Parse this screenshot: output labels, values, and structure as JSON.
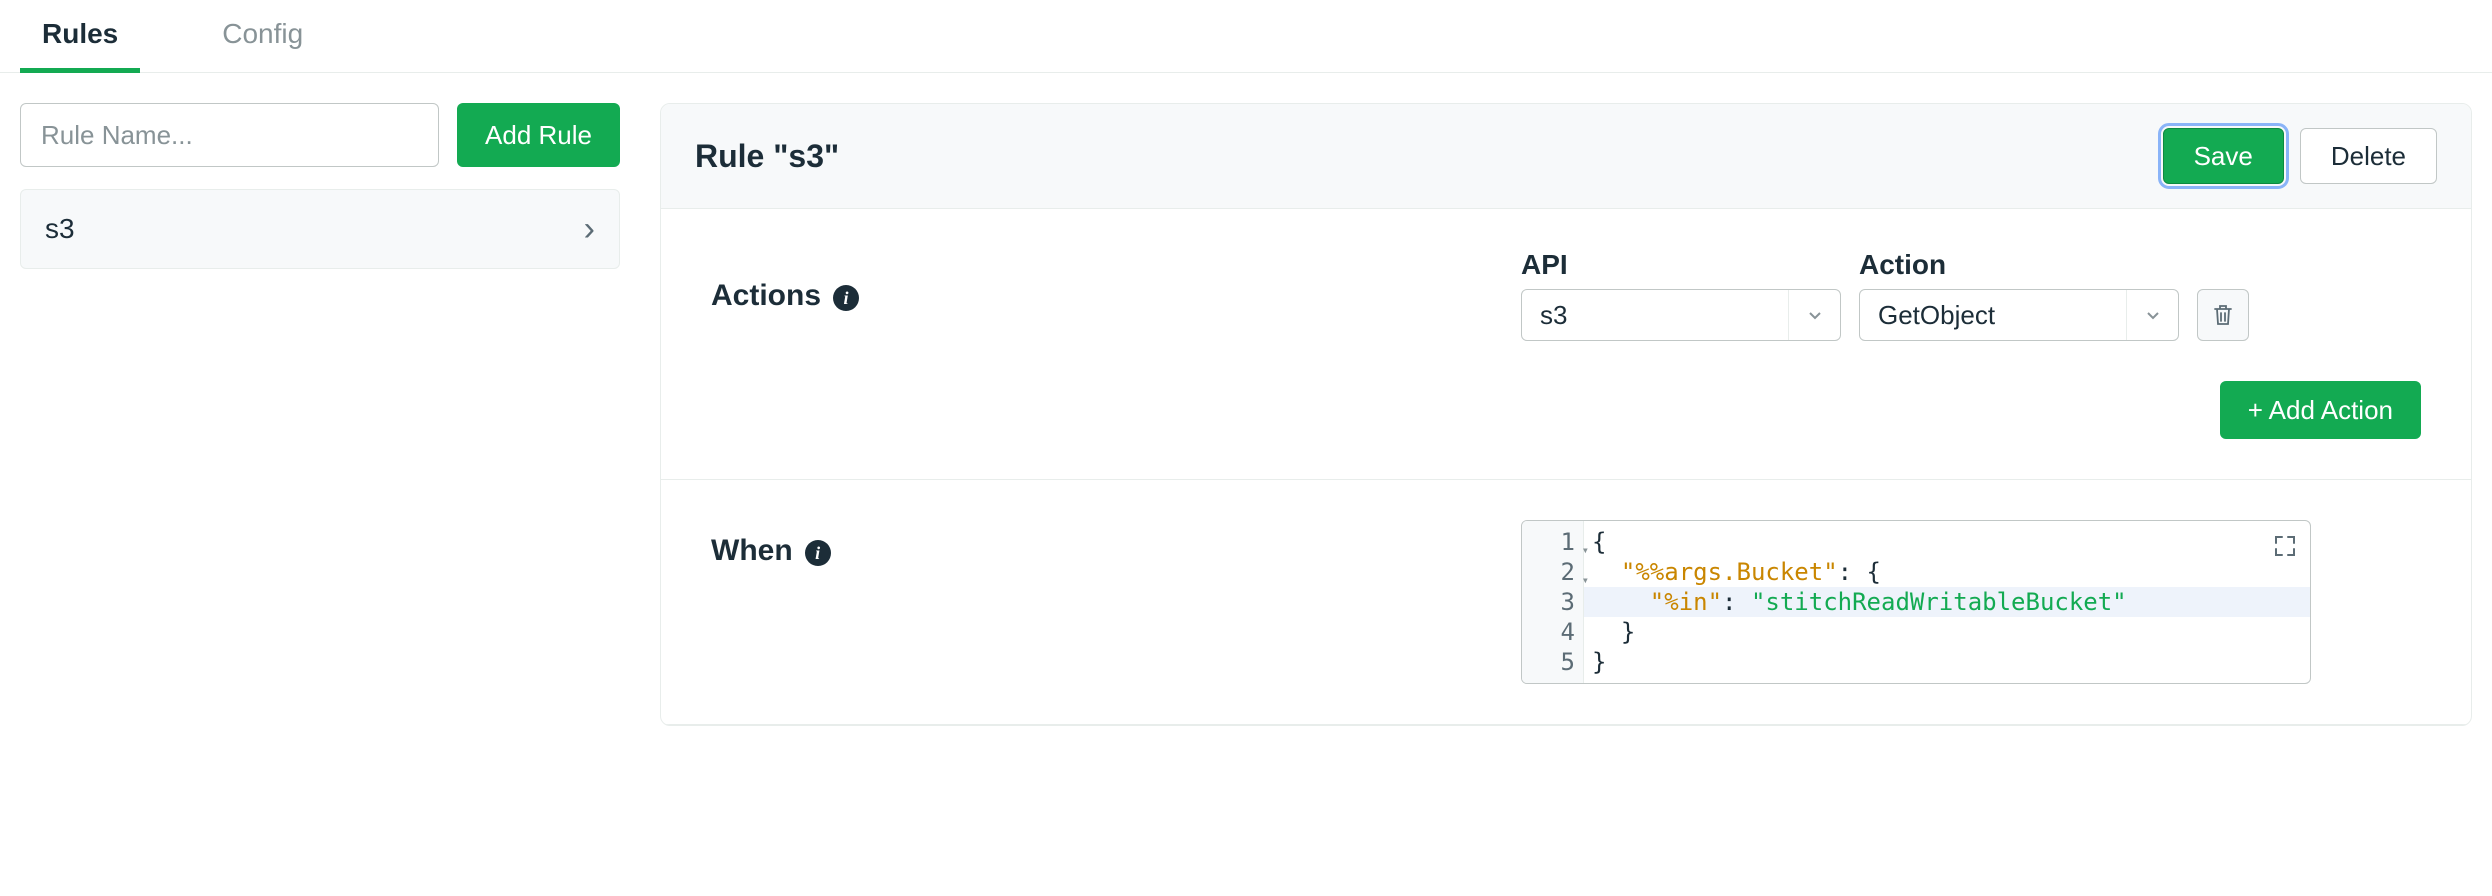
{
  "tabs": {
    "rules": "Rules",
    "config": "Config"
  },
  "sidebar": {
    "rule_name_placeholder": "Rule Name...",
    "add_rule": "Add Rule",
    "items": [
      {
        "label": "s3"
      }
    ]
  },
  "header": {
    "title": "Rule \"s3\"",
    "save": "Save",
    "delete": "Delete"
  },
  "actions": {
    "label": "Actions",
    "api_label": "API",
    "action_label": "Action",
    "api_value": "s3",
    "action_value": "GetObject",
    "add_action": "+ Add Action"
  },
  "when": {
    "label": "When",
    "code": {
      "lines": [
        {
          "n": 1,
          "fold": true,
          "tokens": [
            {
              "t": "punc",
              "v": "{"
            }
          ]
        },
        {
          "n": 2,
          "fold": true,
          "tokens": [
            {
              "t": "indent",
              "v": "  "
            },
            {
              "t": "key",
              "v": "\"%%args.Bucket\""
            },
            {
              "t": "punc",
              "v": ": {"
            }
          ]
        },
        {
          "n": 3,
          "hl": true,
          "tokens": [
            {
              "t": "indent",
              "v": "    "
            },
            {
              "t": "key",
              "v": "\"%in\""
            },
            {
              "t": "punc",
              "v": ": "
            },
            {
              "t": "str",
              "v": "\"stitchReadWritableBucket\""
            }
          ]
        },
        {
          "n": 4,
          "tokens": [
            {
              "t": "indent",
              "v": "  "
            },
            {
              "t": "punc",
              "v": "}"
            }
          ]
        },
        {
          "n": 5,
          "tokens": [
            {
              "t": "punc",
              "v": "}"
            }
          ]
        }
      ]
    }
  },
  "colors": {
    "green": "#13aa52",
    "focus": "#8ab4f8"
  }
}
